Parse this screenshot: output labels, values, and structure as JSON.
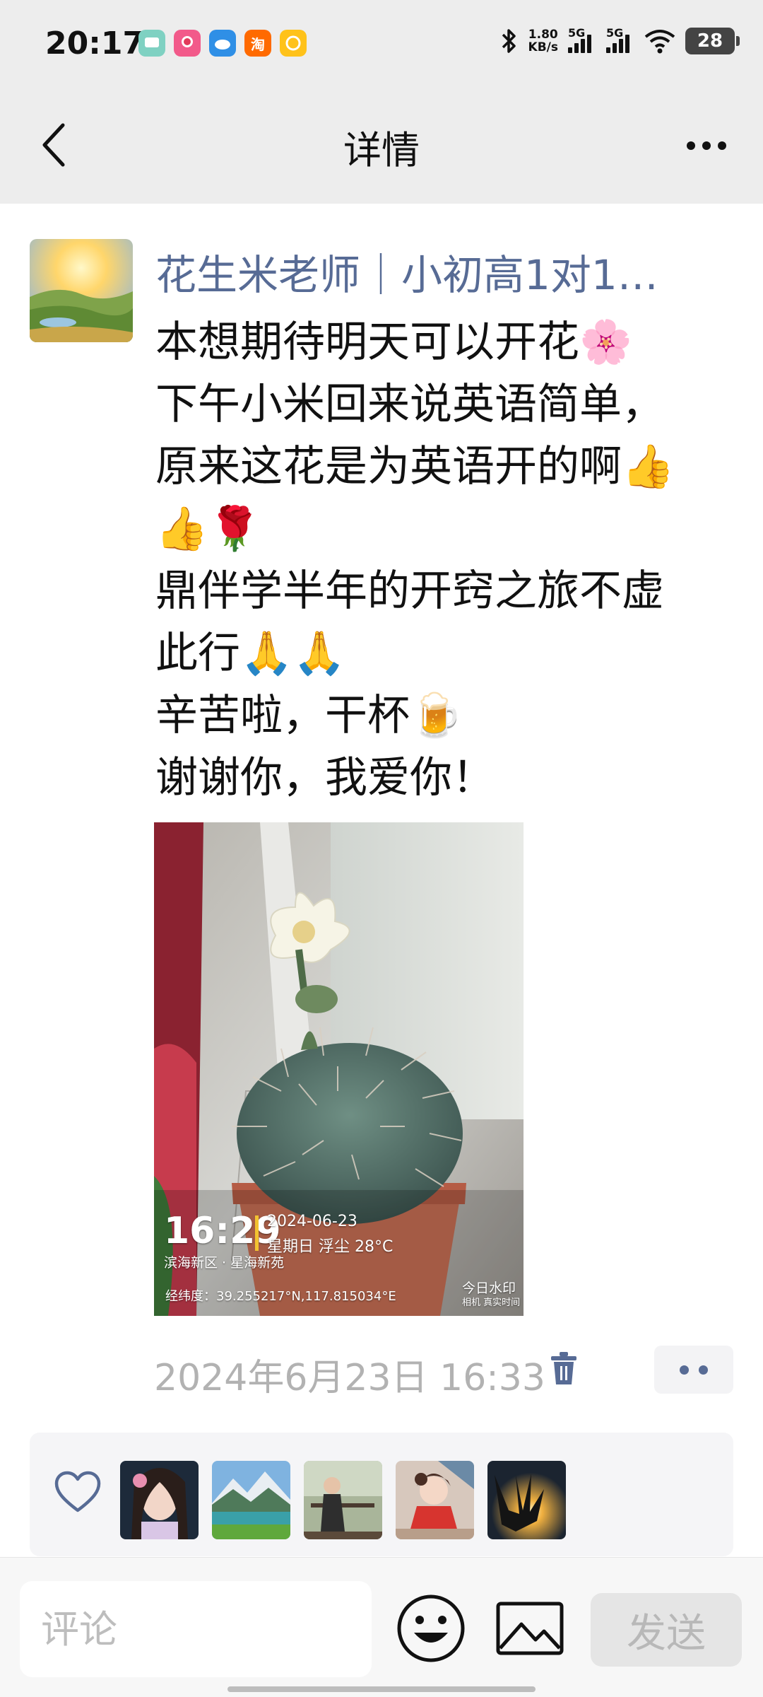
{
  "status_bar": {
    "time": "20:17",
    "net_speed_value": "1.80",
    "net_speed_unit": "KB/s",
    "sim1_label": "5G",
    "sim2_label": "5G",
    "battery": "28",
    "app_icons": [
      "message-app-icon",
      "avatar-app-icon",
      "cloud-app-icon",
      "taobao-app-icon",
      "hand-app-icon"
    ],
    "taobao_label": "淘"
  },
  "header": {
    "title": "详情"
  },
  "post": {
    "author": "花生米老师｜小初高1对1…",
    "text_lines": [
      "本想期待明天可以开花🌸",
      "下午小米回来说英语简单，",
      "原来这花是为英语开的啊👍",
      "👍🌹",
      "鼎伴学半年的开窍之旅不虚",
      "此行🙏🙏",
      "辛苦啦，干杯🍺",
      "谢谢你，我爱你！"
    ],
    "photo_watermark": {
      "time": "16:29",
      "date": "2024-06-23",
      "weather": "星期日 浮尘 28°C",
      "location": "滨海新区 · 星海新苑",
      "coords": "经纬度：39.255217°N,117.815034°E",
      "brand": "今日水印",
      "brand_sub": "相机 真实时间"
    },
    "timestamp": "2024年6月23日 16:33"
  },
  "comment_bar": {
    "placeholder": "评论",
    "send_label": "发送"
  },
  "colors": {
    "author_link": "#576b95",
    "header_bg": "#ededed",
    "timestamp": "#b2b2b2"
  }
}
